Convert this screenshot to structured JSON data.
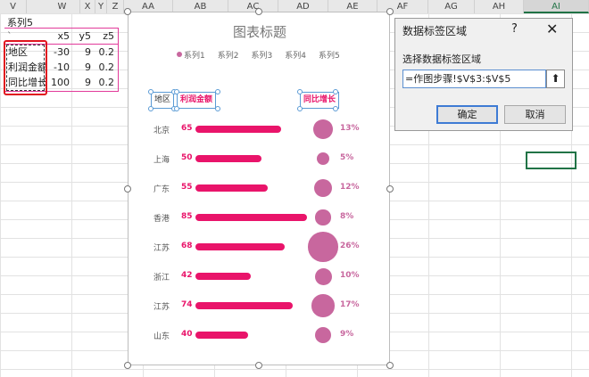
{
  "columns": [
    "V",
    "W",
    "X",
    "Y",
    "Z",
    "AA",
    "AB",
    "AC",
    "AD",
    "AE",
    "AF",
    "AG",
    "AH",
    "AI"
  ],
  "selected_column": "AI",
  "sheet": {
    "series_label": "系列5",
    "quote_cell": "`",
    "headers": [
      "x5",
      "y5",
      "z5"
    ],
    "rows": [
      {
        "label": "地区",
        "x": "-30",
        "y": "9",
        "z": "0.2"
      },
      {
        "label": "利润金额",
        "x": "-10",
        "y": "9",
        "z": "0.2"
      },
      {
        "label": "同比增长",
        "x": "100",
        "y": "9",
        "z": "0.2"
      }
    ]
  },
  "chart": {
    "title": "图表标题",
    "legend": [
      "系列1",
      "系列2",
      "系列3",
      "系列4",
      "系列5"
    ],
    "header_labels": {
      "region": "地区",
      "profit": "利润金额",
      "growth": "同比增长"
    }
  },
  "chart_data": {
    "type": "bar",
    "categories": [
      "北京",
      "上海",
      "广东",
      "香港",
      "江苏",
      "浙江",
      "江苏",
      "山东"
    ],
    "values": [
      65,
      50,
      55,
      85,
      68,
      42,
      74,
      40
    ],
    "growth_pct": [
      13,
      5,
      12,
      8,
      26,
      10,
      17,
      9
    ],
    "growth_labels": [
      "13%",
      "5%",
      "12%",
      "8%",
      "26%",
      "10%",
      "17%",
      "9%"
    ],
    "title": "图表标题",
    "colors": {
      "bar": "#e9146a",
      "bubble": "#c8679e"
    }
  },
  "dialog": {
    "title": "数据标签区域",
    "help": "?",
    "close": "✕",
    "label": "选择数据标签区域",
    "input_value": "=作图步骤!$V$3:$V$5",
    "collapse_icon": "⬆",
    "ok": "确定",
    "cancel": "取消"
  }
}
